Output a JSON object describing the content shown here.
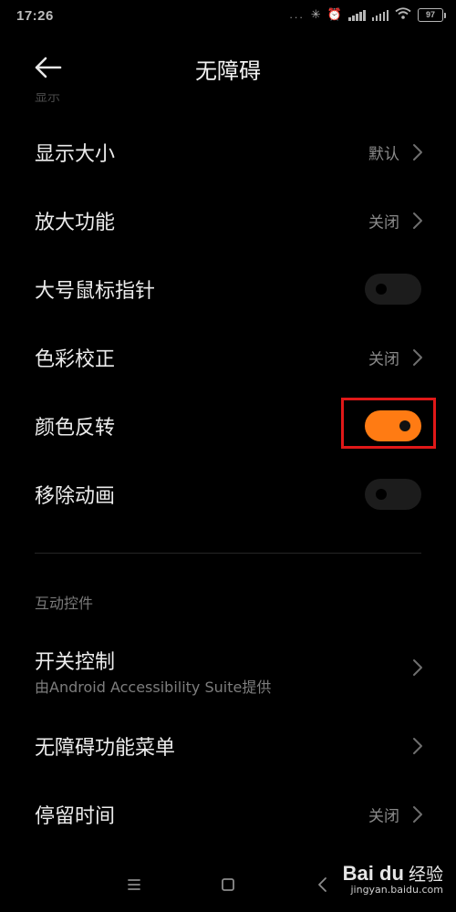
{
  "status_bar": {
    "time": "17:26",
    "dots": "...",
    "battery": "97"
  },
  "header": {
    "title": "无障碍",
    "section_peek": "显示"
  },
  "display_items": [
    {
      "label": "显示大小",
      "value": "默认",
      "kind": "chevron"
    },
    {
      "label": "放大功能",
      "value": "关闭",
      "kind": "chevron"
    },
    {
      "label": "大号鼠标指针",
      "kind": "toggle",
      "on": false
    },
    {
      "label": "色彩校正",
      "value": "关闭",
      "kind": "chevron"
    },
    {
      "label": "颜色反转",
      "kind": "toggle",
      "on": true
    },
    {
      "label": "移除动画",
      "kind": "toggle",
      "on": false
    }
  ],
  "interaction_section": {
    "title": "互动控件",
    "items": [
      {
        "label": "开关控制",
        "sublabel": "由Android Accessibility Suite提供",
        "kind": "chevron"
      },
      {
        "label": "无障碍功能菜单",
        "kind": "chevron"
      },
      {
        "label": "停留时间",
        "value": "关闭",
        "kind": "chevron"
      }
    ]
  },
  "colors": {
    "background": "#000000",
    "accent_toggle_on": "#ff7b13",
    "highlight_box": "#e01818"
  },
  "watermark": {
    "logo": "Bai  du",
    "text": "经验",
    "url": "jingyan.baidu.com"
  }
}
